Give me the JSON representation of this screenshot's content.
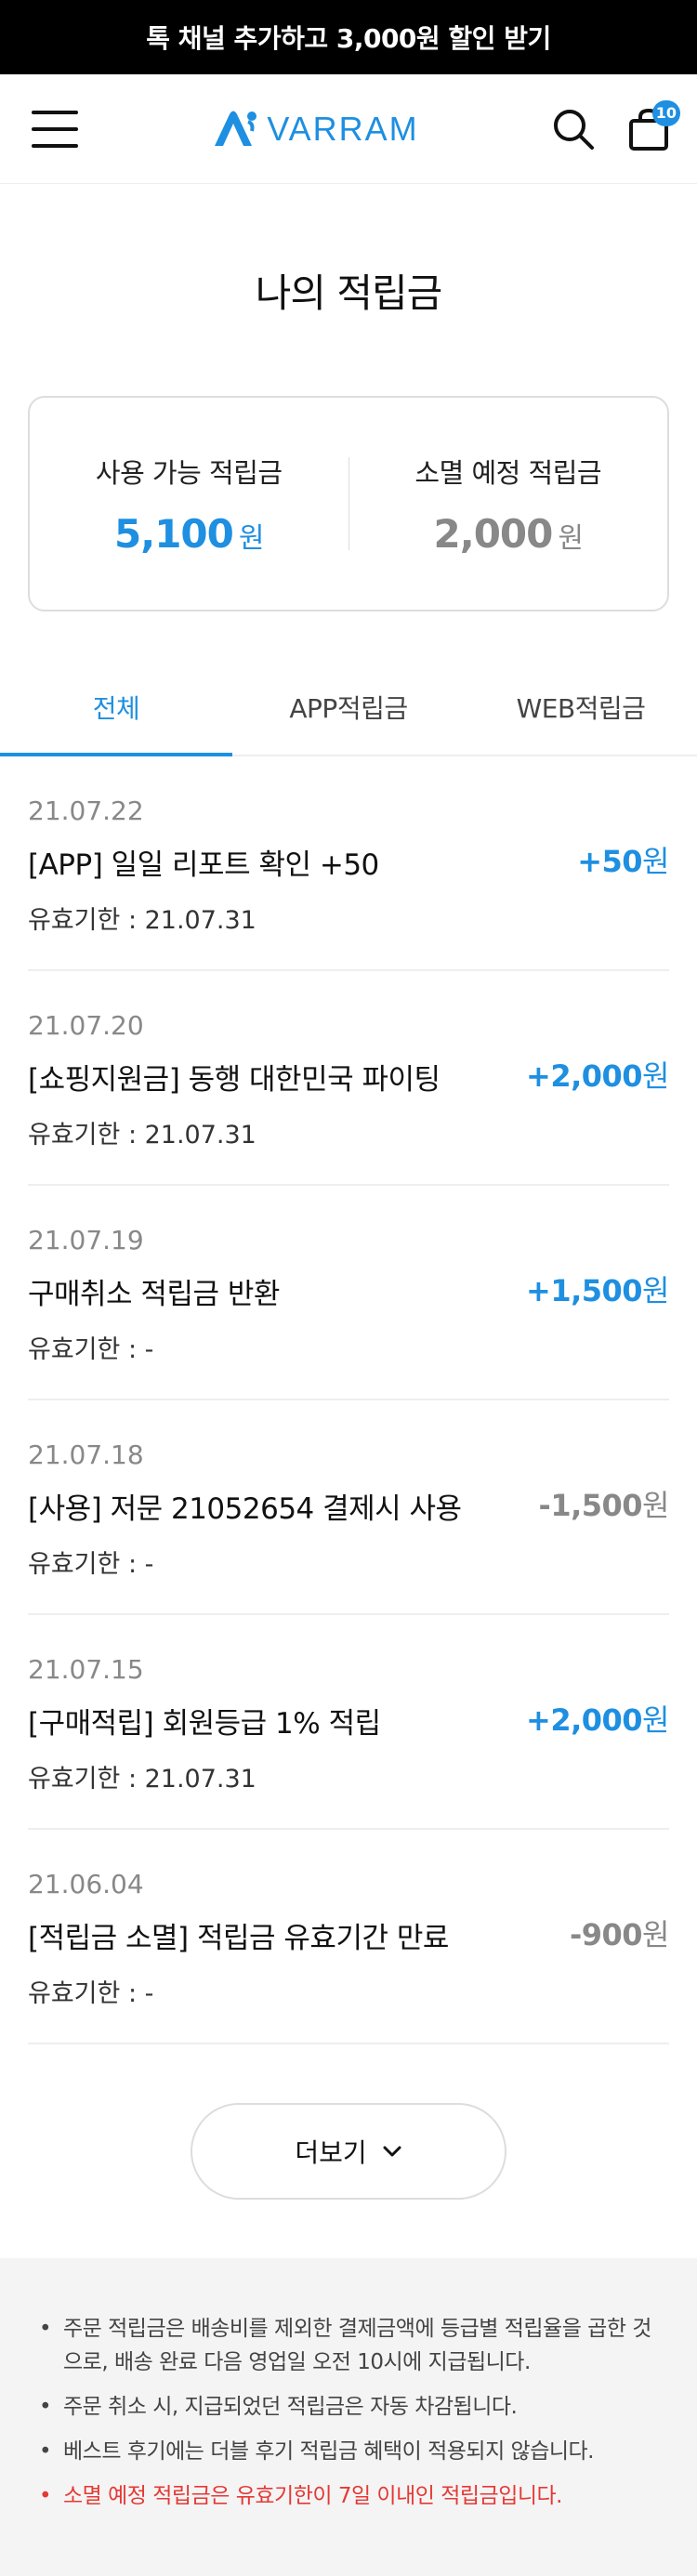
{
  "promo": {
    "text": "톡 채널 추가하고 3,000원 할인 받기"
  },
  "header": {
    "logo_text": "VARRAM",
    "cart_count": "10"
  },
  "page_title": "나의 적립금",
  "summary": {
    "available": {
      "label": "사용 가능 적립금",
      "value": "5,100",
      "unit": "원"
    },
    "expiring": {
      "label": "소멸 예정 적립금",
      "value": "2,000",
      "unit": "원"
    }
  },
  "tabs": [
    {
      "label": "전체",
      "active": true
    },
    {
      "label": "APP적립금",
      "active": false
    },
    {
      "label": "WEB적립금",
      "active": false
    }
  ],
  "transactions": [
    {
      "date": "21.07.22",
      "title": "[APP] 일일 리포트 확인 +50",
      "expiry": "유효기한 : 21.07.31",
      "amount": "+50",
      "unit": "원",
      "type": "plus"
    },
    {
      "date": "21.07.20",
      "title": "[쇼핑지원금] 동행 대한민국 파이팅",
      "expiry": "유효기한 : 21.07.31",
      "amount": "+2,000",
      "unit": "원",
      "type": "plus"
    },
    {
      "date": "21.07.19",
      "title": "구매취소 적립금 반환",
      "expiry": "유효기한 : -",
      "amount": "+1,500",
      "unit": "원",
      "type": "plus"
    },
    {
      "date": "21.07.18",
      "title": "[사용] 저문 21052654 결제시 사용",
      "expiry": "유효기한 : -",
      "amount": "-1,500",
      "unit": "원",
      "type": "minus"
    },
    {
      "date": "21.07.15",
      "title": "[구매적립] 회원등급 1% 적립",
      "expiry": "유효기한 : 21.07.31",
      "amount": "+2,000",
      "unit": "원",
      "type": "plus"
    },
    {
      "date": "21.06.04",
      "title": "[적립금 소멸] 적립금 유효기간 만료",
      "expiry": "유효기한 : -",
      "amount": "-900",
      "unit": "원",
      "type": "minus"
    }
  ],
  "more_button": {
    "label": "더보기"
  },
  "notices": [
    {
      "text": "주문 적립금은 배송비를 제외한 결제금액에 등급별 적립율을 곱한 것으로, 배송 완료 다음 영업일 오전 10시에 지급됩니다.",
      "warn": false
    },
    {
      "text": "주문 취소 시, 지급되었던 적립금은 자동 차감됩니다.",
      "warn": false
    },
    {
      "text": "베스트 후기에는 더블 후기 적립금 혜택이 적용되지 않습니다.",
      "warn": false
    },
    {
      "text": "소멸 예정 적립금은 유효기한이 7일 이내인 적립금입니다.",
      "warn": true
    }
  ],
  "colors": {
    "accent": "#1e8fe1",
    "negative": "#888888",
    "warning": "#e53935"
  }
}
